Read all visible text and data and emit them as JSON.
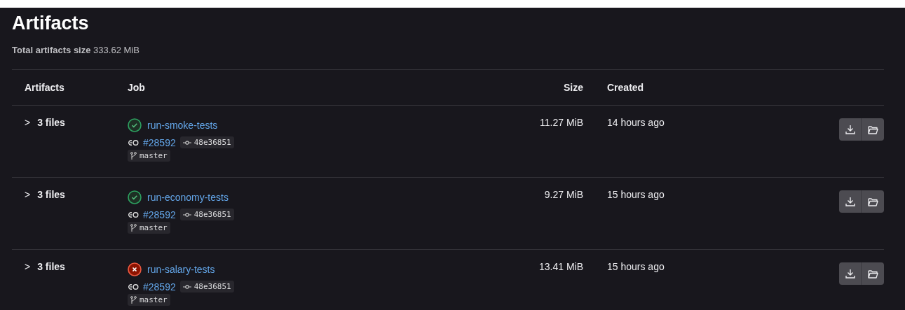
{
  "title": "Artifacts",
  "total": {
    "label": "Total artifacts size",
    "value": "333.62 MiB"
  },
  "columns": [
    "Artifacts",
    "Job",
    "Size",
    "Created"
  ],
  "rows": [
    {
      "toggle": ">",
      "files": "3 files",
      "kind": "success",
      "job": "run-smoke-tests",
      "pipeline": "#28592",
      "commit": "48e36851",
      "branch": "master",
      "size": "11.27 MiB",
      "created": "14 hours ago",
      "expanded": false
    },
    {
      "toggle": ">",
      "files": "3 files",
      "kind": "success",
      "job": "run-economy-tests",
      "pipeline": "#28592",
      "commit": "48e36851",
      "branch": "master",
      "size": "9.27 MiB",
      "created": "15 hours ago",
      "expanded": false
    },
    {
      "toggle": ">",
      "files": "3 files",
      "kind": "failed",
      "job": "run-salary-tests",
      "pipeline": "#28592",
      "commit": "48e36851",
      "branch": "master",
      "size": "13.41 MiB",
      "created": "15 hours ago",
      "expanded": false
    }
  ]
}
